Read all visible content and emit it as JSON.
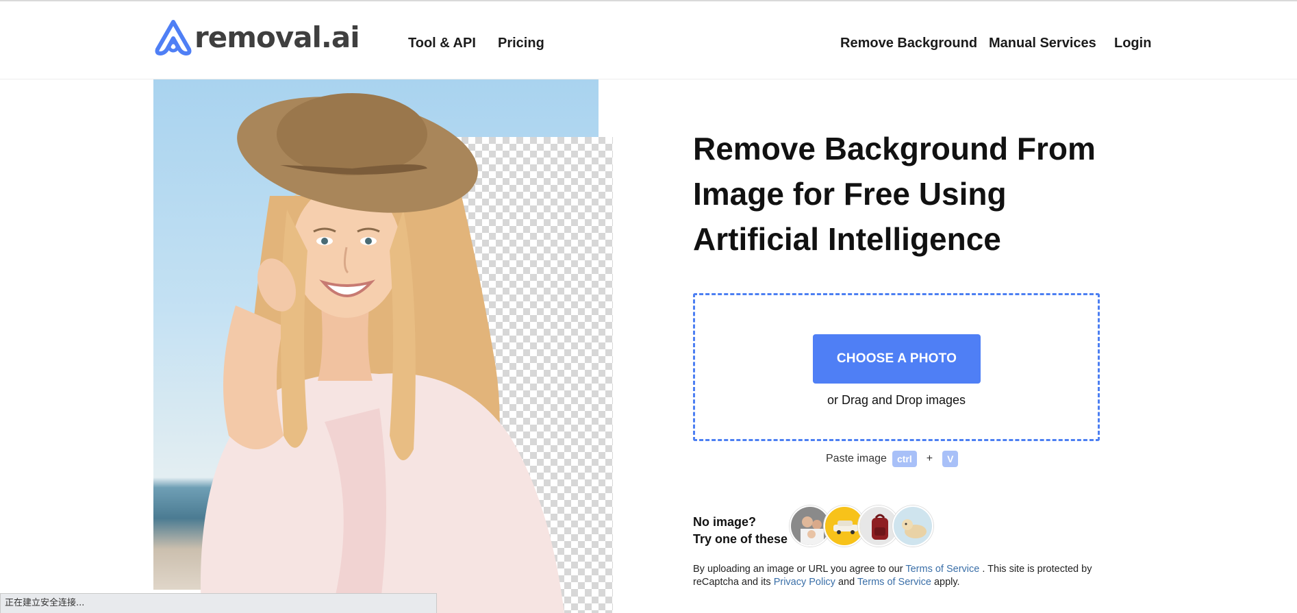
{
  "brand": {
    "logo_text": "removal.ai",
    "accent_color": "#4f7ff5",
    "logo_icon": "removal-ai-logo-icon"
  },
  "nav": {
    "tool_api": "Tool & API",
    "pricing": "Pricing",
    "remove_background": "Remove Background",
    "manual_services": "Manual Services",
    "login": "Login"
  },
  "hero": {
    "headline": "Remove Background From Image for Free Using Artificial Intelligence"
  },
  "upload": {
    "button_label": "CHOOSE A PHOTO",
    "drag_text": "or Drag and Drop images",
    "paste_label": "Paste image",
    "paste_key_1": "ctrl",
    "paste_plus": "+",
    "paste_key_2": "V"
  },
  "samples": {
    "line1": "No image?",
    "line2": "Try one of these",
    "items": [
      "sample-family",
      "sample-car",
      "sample-backpack",
      "sample-dog"
    ]
  },
  "legal": {
    "text_1": "By uploading an image or URL you agree to our ",
    "link_terms_1": "Terms of Service",
    "text_2": " . This site is protected by reCaptcha and its ",
    "link_privacy": "Privacy Policy",
    "text_3": " and ",
    "link_terms_2": "Terms of Service",
    "text_4": " apply."
  },
  "status_bar": {
    "text": "正在建立安全连接..."
  }
}
